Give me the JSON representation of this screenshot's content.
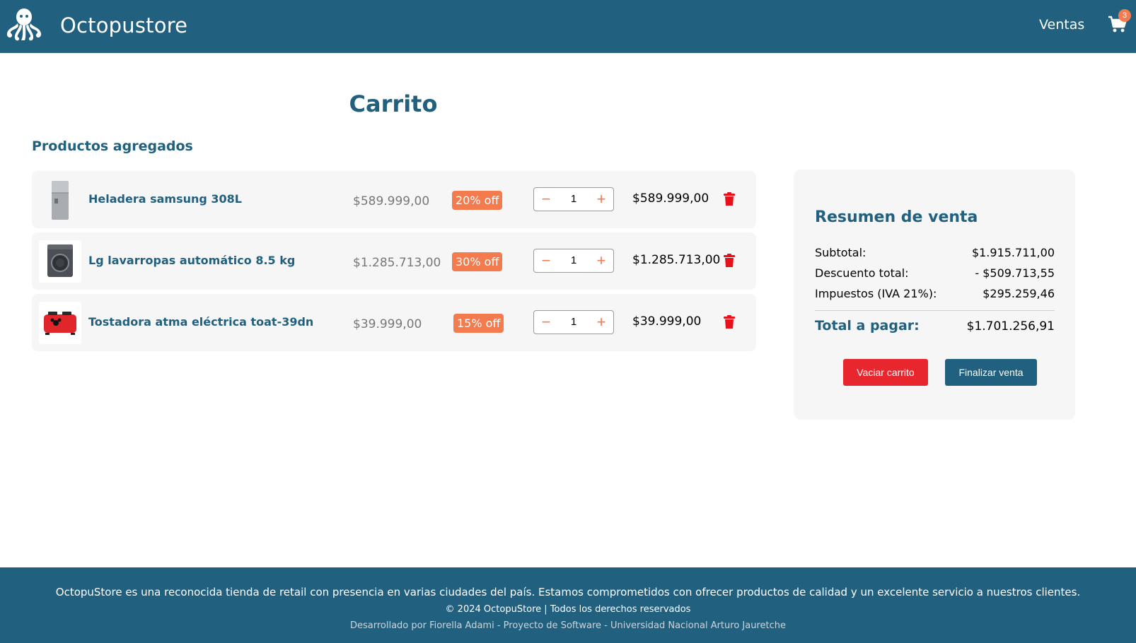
{
  "header": {
    "brand": "Octopustore",
    "nav_ventas": "Ventas",
    "cart_count": "3"
  },
  "page": {
    "title": "Carrito",
    "section_title": "Productos agregados"
  },
  "cart": {
    "items": [
      {
        "name": "Heladera samsung 308L",
        "original_price": "$589.999,00",
        "discount": "20% off",
        "quantity": "1",
        "final_price": "$589.999,00",
        "minus": "−",
        "plus": "+"
      },
      {
        "name": "Lg lavarropas automático 8.5 kg",
        "original_price": "$1.285.713,00",
        "discount": "30% off",
        "quantity": "1",
        "final_price": "$1.285.713,00",
        "minus": "−",
        "plus": "+"
      },
      {
        "name": "Tostadora atma eléctrica toat-39dn",
        "original_price": "$39.999,00",
        "discount": "15% off",
        "quantity": "1",
        "final_price": "$39.999,00",
        "minus": "−",
        "plus": "+"
      }
    ]
  },
  "summary": {
    "title": "Resumen de venta",
    "subtotal_label": "Subtotal:",
    "subtotal_value": "$1.915.711,00",
    "discount_label": "Descuento total:",
    "discount_value": "- $509.713,55",
    "tax_label": "Impuestos (IVA 21%):",
    "tax_value": "$295.259,46",
    "total_label": "Total a pagar:",
    "total_value": "$1.701.256,91",
    "btn_empty": "Vaciar carrito",
    "btn_finish": "Finalizar venta"
  },
  "footer": {
    "description": "OctopuStore es una reconocida tienda de retail con presencia en varias ciudades del país. Estamos comprometidos con ofrecer productos de calidad y un excelente servicio a nuestros clientes.",
    "copyright": "© 2024 OctopuStore | Todos los derechos reservados",
    "credits": "Desarrollado por Fiorella Adami - Proyecto de Software - Universidad Nacional Arturo Jauretche"
  },
  "colors": {
    "primary": "#22607f",
    "accent": "#f47b4e",
    "danger": "#e8262d",
    "card_bg": "#f6f6f6"
  },
  "icons": {
    "logo": "octopus-logo-icon",
    "cart": "shopping-cart-icon",
    "delete": "trash-icon"
  }
}
